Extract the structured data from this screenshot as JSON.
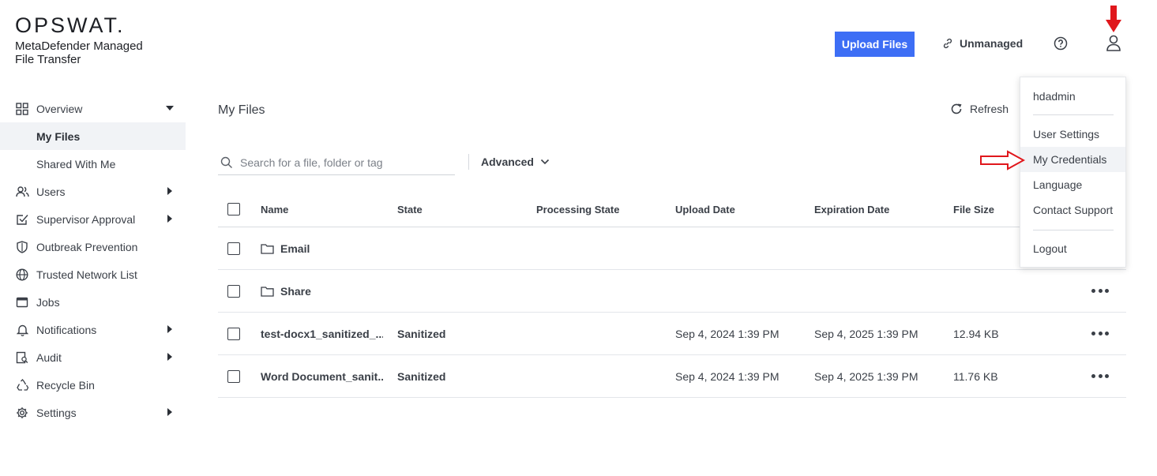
{
  "brand": {
    "logo": "OPSWAT.",
    "product": "MetaDefender Managed File Transfer"
  },
  "topbar": {
    "upload_label": "Upload Files",
    "unmanaged_label": "Unmanaged",
    "help_icon": "help-circle-icon",
    "user_icon": "user-icon"
  },
  "sidebar": {
    "items": [
      {
        "label": "Overview",
        "icon": "grid-icon",
        "expanded": true
      },
      {
        "label": "My Files",
        "active": true
      },
      {
        "label": "Shared With Me"
      },
      {
        "label": "Users",
        "icon": "users-icon"
      },
      {
        "label": "Supervisor Approval",
        "icon": "checkbox-icon"
      },
      {
        "label": "Outbreak Prevention",
        "icon": "shield-icon"
      },
      {
        "label": "Trusted Network List",
        "icon": "globe-icon"
      },
      {
        "label": "Jobs",
        "icon": "window-icon"
      },
      {
        "label": "Notifications",
        "icon": "bell-icon"
      },
      {
        "label": "Audit",
        "icon": "audit-icon"
      },
      {
        "label": "Recycle Bin",
        "icon": "recycle-icon"
      },
      {
        "label": "Settings",
        "icon": "gear-icon"
      }
    ]
  },
  "main": {
    "title": "My Files",
    "refresh_label": "Refresh",
    "search_placeholder": "Search for a file, folder or tag",
    "advanced_label": "Advanced",
    "columns": {
      "name": "Name",
      "state": "State",
      "processing_state": "Processing State",
      "upload_date": "Upload Date",
      "expiration_date": "Expiration Date",
      "file_size": "File Size"
    },
    "rows": [
      {
        "name": "Email",
        "type": "folder",
        "state": "",
        "processing_state": "",
        "upload_date": "",
        "expiration_date": "",
        "file_size": ""
      },
      {
        "name": "Share",
        "type": "folder",
        "state": "",
        "processing_state": "",
        "upload_date": "",
        "expiration_date": "",
        "file_size": ""
      },
      {
        "name": "test-docx1_sanitized_...",
        "type": "file",
        "state": "Sanitized",
        "processing_state": "",
        "upload_date": "Sep 4, 2024 1:39 PM",
        "expiration_date": "Sep 4, 2025 1:39 PM",
        "file_size": "12.94 KB"
      },
      {
        "name": "Word Document_sanit...",
        "type": "file",
        "state": "Sanitized",
        "processing_state": "",
        "upload_date": "Sep 4, 2024 1:39 PM",
        "expiration_date": "Sep 4, 2025 1:39 PM",
        "file_size": "11.76 KB"
      }
    ]
  },
  "user_menu": {
    "username": "hdadmin",
    "items": [
      "User Settings",
      "My Credentials",
      "Language",
      "Contact Support",
      "Logout"
    ],
    "highlighted": "My Credentials"
  },
  "colors": {
    "accent": "#3d6ef5",
    "annotation_arrow": "#e0171c"
  }
}
